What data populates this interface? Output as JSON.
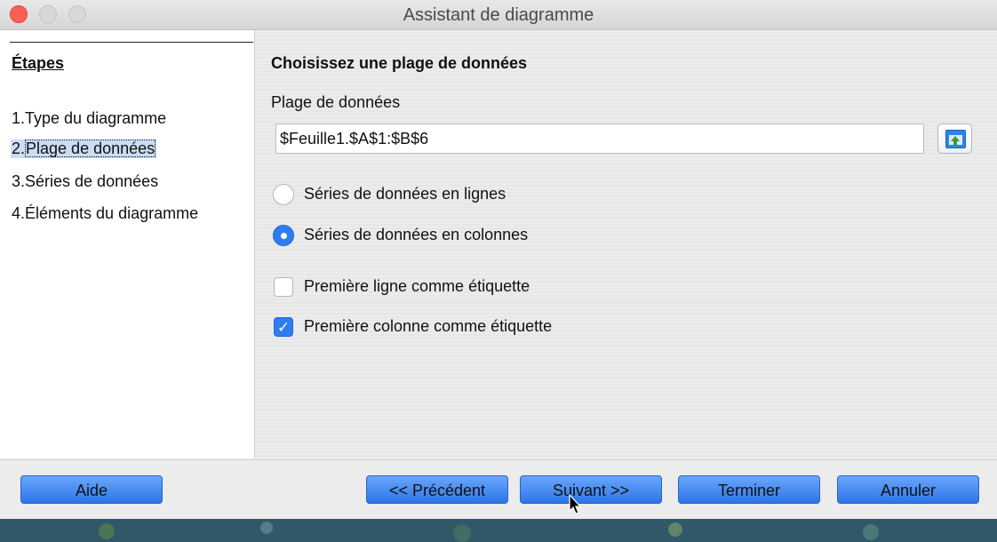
{
  "window": {
    "title": "Assistant de diagramme"
  },
  "steps": {
    "heading": "Étapes",
    "items": [
      {
        "number": "1.",
        "label": "Type du diagramme"
      },
      {
        "number": "2.",
        "label": "Plage de données"
      },
      {
        "number": "3.",
        "label": "Séries de données"
      },
      {
        "number": "4.",
        "label": "Éléments du diagramme"
      }
    ],
    "selected_index": 1
  },
  "content": {
    "heading": "Choisissez une plage de données",
    "range_label": "Plage de données",
    "range_value": "$Feuille1.$A$1:$B$6",
    "shrink_icon": "shrink-range-icon",
    "options": {
      "rows_label": "Séries de données en lignes",
      "cols_label": "Séries de données en colonnes",
      "selected": "cols",
      "first_row_label": "Première ligne comme étiquette",
      "first_row_checked": false,
      "first_col_label": "Première colonne comme étiquette",
      "first_col_checked": true
    }
  },
  "footer": {
    "help": "Aide",
    "previous": "<< Précédent",
    "next": "Suivant >>",
    "finish": "Terminer",
    "cancel": "Annuler"
  },
  "colors": {
    "accent": "#2d7df0",
    "button": "#4a8ef5",
    "close": "#fd5f57"
  }
}
